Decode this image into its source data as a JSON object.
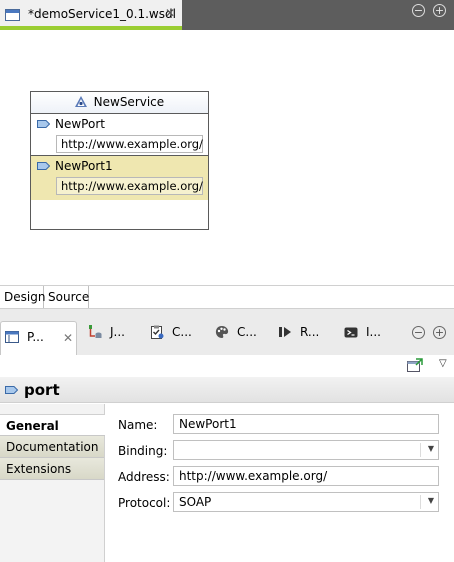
{
  "editor": {
    "tab_title": "*demoService1_0.1.wsdl",
    "close_glyph": "✕",
    "min_glyph": "−",
    "max_glyph": "+"
  },
  "canvas": {
    "service_name": "NewService",
    "ports": [
      {
        "name": "NewPort",
        "address": "http://www.example.org/"
      },
      {
        "name": "NewPort1",
        "address": "http://www.example.org/"
      }
    ],
    "selected_fill": "#efe7b0"
  },
  "design_tabs": {
    "design": "Design",
    "source": "Source"
  },
  "views": {
    "tabs": [
      {
        "label": "P...",
        "icon": "properties-icon"
      },
      {
        "label": "J...",
        "icon": "jobs-icon"
      },
      {
        "label": "C...",
        "icon": "clipboard-check-icon"
      },
      {
        "label": "C...",
        "icon": "palette-icon"
      },
      {
        "label": "R...",
        "icon": "run-icon"
      },
      {
        "label": "I...",
        "icon": "console-icon"
      }
    ],
    "close_glyph": "✕",
    "min_glyph": "−",
    "max_glyph": "+"
  },
  "properties": {
    "title": "port",
    "menu_glyph": "▽",
    "side_tabs": [
      "General",
      "Documentation",
      "Extensions"
    ],
    "fields": {
      "name_label": "Name:",
      "name_value": "NewPort1",
      "binding_label": "Binding:",
      "binding_value": "",
      "address_label": "Address:",
      "address_value": "http://www.example.org/",
      "protocol_label": "Protocol:",
      "protocol_value": "SOAP"
    },
    "dropdown_glyph": "▼"
  }
}
